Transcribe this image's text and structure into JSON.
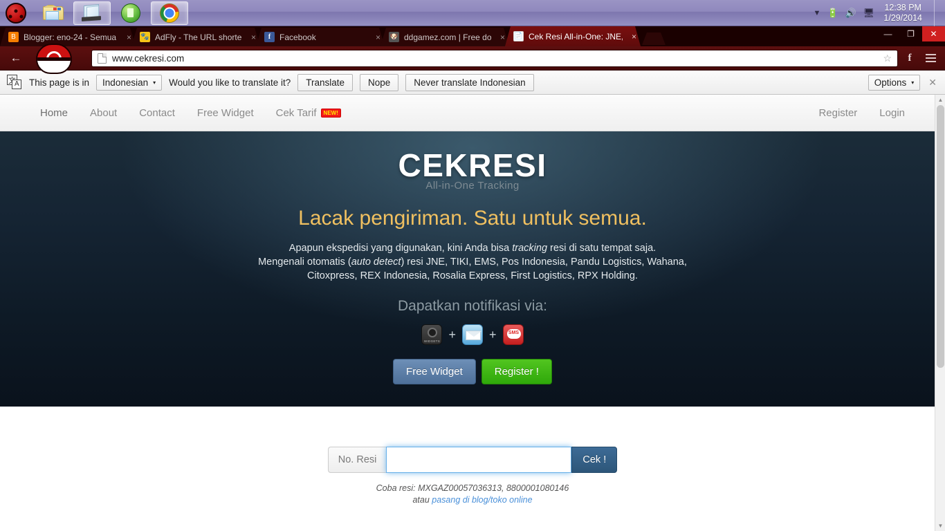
{
  "taskbar": {
    "start_icon": "start-orb-icon",
    "items": [
      {
        "name": "folder-explorer",
        "icon": "folder-icon"
      },
      {
        "name": "notepad-window",
        "icon": "notepad-icon",
        "active": true
      },
      {
        "name": "green-app",
        "icon": "green-circle-icon"
      },
      {
        "name": "chrome-browser",
        "icon": "chrome-icon",
        "active": true
      }
    ],
    "tray": {
      "overflow_icon": "chevron-up-icon",
      "battery_icon": "battery-icon",
      "volume_icon": "volume-icon",
      "network_icon": "network-icon",
      "time": "12:38 PM",
      "date": "1/29/2014"
    }
  },
  "browser": {
    "tabs": [
      {
        "title": "Blogger: eno-24 - Semua ",
        "favicon": "blogger-icon",
        "close": "×",
        "active": false
      },
      {
        "title": "AdFly - The URL shortener",
        "favicon": "adfly-icon",
        "close": "×",
        "active": false
      },
      {
        "title": "Facebook",
        "favicon": "facebook-icon",
        "close": "×",
        "active": false
      },
      {
        "title": "ddgamez.com | Free down",
        "favicon": "ddgamez-icon",
        "close": "×",
        "active": false
      },
      {
        "title": "Cek Resi All-in-One: JNE, ",
        "favicon": "page-icon",
        "close": "×",
        "active": true
      }
    ],
    "new_tab_label": "",
    "window_controls": {
      "minimize": "—",
      "maximize": "❐",
      "close": "✕"
    },
    "toolbar": {
      "back_icon": "back-arrow-icon",
      "forward_icon": "forward-arrow-icon",
      "reload_icon": "reload-icon",
      "avatar_icon": "pokeball-avatar-icon",
      "page_icon": "page-document-icon",
      "url": "www.cekresi.com",
      "bookmark_icon": "star-icon",
      "facebook_ext_icon": "facebook-extension-icon",
      "menu_icon": "hamburger-menu-icon"
    }
  },
  "infobar": {
    "icon": "translate-icon",
    "prefix": "This page is in",
    "language": "Indonesian",
    "caret": "▾",
    "question": "Would you like to translate it?",
    "translate_label": "Translate",
    "nope_label": "Nope",
    "never_label": "Never translate Indonesian",
    "options_label": "Options",
    "options_caret": "▾",
    "close_label": "✕"
  },
  "site": {
    "nav_left": [
      {
        "label": "Home"
      },
      {
        "label": "About"
      },
      {
        "label": "Contact"
      },
      {
        "label": "Free Widget"
      },
      {
        "label": "Cek Tarif",
        "badge": "NEW!"
      }
    ],
    "nav_right": [
      {
        "label": "Register"
      },
      {
        "label": "Login"
      }
    ],
    "hero": {
      "logo": "CEKRESI",
      "logo_sub": "All-in-One Tracking",
      "tagline": "Lacak pengiriman. Satu untuk semua.",
      "desc_line1_a": "Apapun ekspedisi yang digunakan, kini Anda bisa ",
      "desc_line1_em": "tracking",
      "desc_line1_b": " resi di satu tempat saja.",
      "desc_line2_a": "Mengenali otomatis (",
      "desc_line2_em": "auto detect",
      "desc_line2_b": ") resi JNE, TIKI, EMS, Pos Indonesia, Pandu Logistics, Wahana,",
      "desc_line3": "Citoxpress, REX Indonesia, Rosalia Express, First Logistics, RPX Holding.",
      "notif_title": "Dapatkan notifikasi via:",
      "notif_icons": [
        {
          "name": "widgets-icon",
          "label": "WIDGETS"
        },
        {
          "name": "email-icon"
        },
        {
          "name": "sms-icon",
          "label": "SMS"
        }
      ],
      "plus": "+",
      "btn_widget": "Free Widget",
      "btn_register": "Register !"
    },
    "search": {
      "addon_label": "No. Resi",
      "input_value": "",
      "input_placeholder": "",
      "button_label": "Cek !",
      "hint_line1": "Coba resi: MXGAZ00057036313, 8800001080146",
      "hint_line2_prefix": "atau ",
      "hint_line2_link": "pasang di blog/toko online"
    }
  },
  "colors": {
    "hero_top": "#1b2c39",
    "hero_bottom": "#0a121c",
    "tagline": "#f0c060",
    "accent_green": "#2fa80a",
    "accent_blue": "#4e7099",
    "tab_active": "#7a0f0f"
  }
}
